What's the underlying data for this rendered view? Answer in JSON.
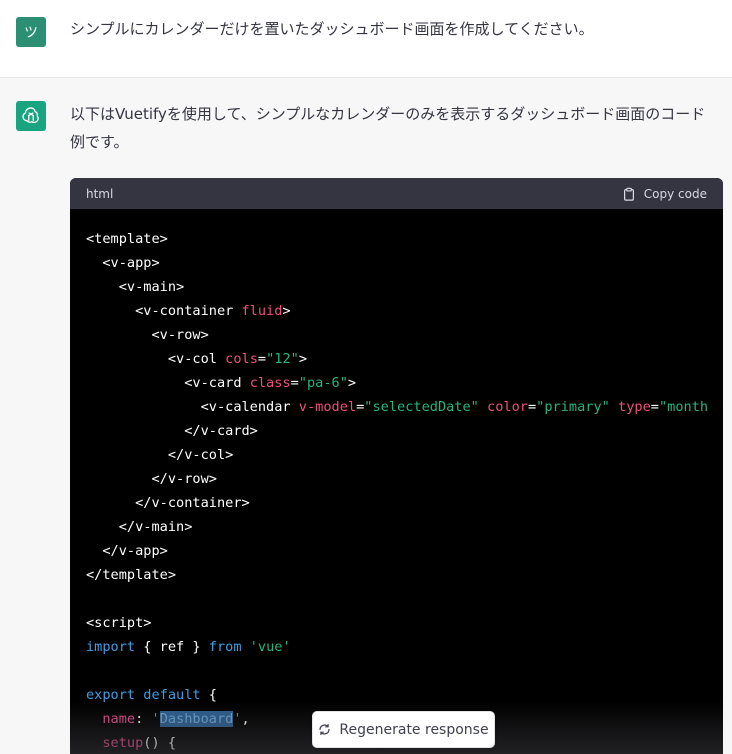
{
  "user_message": {
    "avatar_glyph": "ツ",
    "avatar_color": "#2a8f73",
    "text": "シンプルにカレンダーだけを置いたダッシュボード画面を作成してください。"
  },
  "assistant_message": {
    "avatar_icon": "openai-logo-icon",
    "avatar_color": "#19a37f",
    "text": "以下はVuetifyを使用して、シンプルなカレンダーのみを表示するダッシュボード画面のコード例です。"
  },
  "code_block": {
    "language": "html",
    "copy_label": "Copy code",
    "lines": [
      [
        {
          "t": "<template>",
          "c": "tag"
        }
      ],
      [
        {
          "t": "  <v-app>",
          "c": "tag"
        }
      ],
      [
        {
          "t": "    <v-main>",
          "c": "tag"
        }
      ],
      [
        {
          "t": "      <v-container ",
          "c": "tag"
        },
        {
          "t": "fluid",
          "c": "attr-pink"
        },
        {
          "t": ">",
          "c": "tag"
        }
      ],
      [
        {
          "t": "        <v-row>",
          "c": "tag"
        }
      ],
      [
        {
          "t": "          <v-col ",
          "c": "tag"
        },
        {
          "t": "cols",
          "c": "attr-pink"
        },
        {
          "t": "=",
          "c": "tag"
        },
        {
          "t": "\"12\"",
          "c": "str"
        },
        {
          "t": ">",
          "c": "tag"
        }
      ],
      [
        {
          "t": "            <v-card ",
          "c": "tag"
        },
        {
          "t": "class",
          "c": "attr-pink"
        },
        {
          "t": "=",
          "c": "tag"
        },
        {
          "t": "\"pa-6\"",
          "c": "str"
        },
        {
          "t": ">",
          "c": "tag"
        }
      ],
      [
        {
          "t": "              <v-calendar ",
          "c": "tag"
        },
        {
          "t": "v-model",
          "c": "attr-pink"
        },
        {
          "t": "=",
          "c": "tag"
        },
        {
          "t": "\"selectedDate\"",
          "c": "str"
        },
        {
          "t": " ",
          "c": "tag"
        },
        {
          "t": "color",
          "c": "attr-pink"
        },
        {
          "t": "=",
          "c": "tag"
        },
        {
          "t": "\"primary\"",
          "c": "str"
        },
        {
          "t": " ",
          "c": "tag"
        },
        {
          "t": "type",
          "c": "attr-pink"
        },
        {
          "t": "=",
          "c": "tag"
        },
        {
          "t": "\"month",
          "c": "str"
        }
      ],
      [
        {
          "t": "            </v-card>",
          "c": "tag"
        }
      ],
      [
        {
          "t": "          </v-col>",
          "c": "tag"
        }
      ],
      [
        {
          "t": "        </v-row>",
          "c": "tag"
        }
      ],
      [
        {
          "t": "      </v-container>",
          "c": "tag"
        }
      ],
      [
        {
          "t": "    </v-main>",
          "c": "tag"
        }
      ],
      [
        {
          "t": "  </v-app>",
          "c": "tag"
        }
      ],
      [
        {
          "t": "</template>",
          "c": "tag"
        }
      ],
      [
        {
          "t": "",
          "c": "tag"
        }
      ],
      [
        {
          "t": "<script>",
          "c": "tag"
        }
      ],
      [
        {
          "t": "import",
          "c": "kw"
        },
        {
          "t": " { ref } ",
          "c": "tag"
        },
        {
          "t": "from",
          "c": "kw"
        },
        {
          "t": " ",
          "c": "tag"
        },
        {
          "t": "'vue'",
          "c": "str"
        }
      ],
      [
        {
          "t": "",
          "c": "tag"
        }
      ],
      [
        {
          "t": "export",
          "c": "kw"
        },
        {
          "t": " ",
          "c": "tag"
        },
        {
          "t": "default",
          "c": "kw"
        },
        {
          "t": " {",
          "c": "tag"
        }
      ],
      [
        {
          "t": "  ",
          "c": "tag"
        },
        {
          "t": "name",
          "c": "fn"
        },
        {
          "t": ": ",
          "c": "tag"
        },
        {
          "t": "'",
          "c": "str"
        },
        {
          "t": "Dashboard",
          "c": "hl"
        },
        {
          "t": "'",
          "c": "str"
        },
        {
          "t": ",",
          "c": "tag"
        }
      ],
      [
        {
          "t": "  ",
          "c": "tag"
        },
        {
          "t": "setup",
          "c": "fn"
        },
        {
          "t": "() {",
          "c": "tag"
        }
      ]
    ]
  },
  "regenerate_button": {
    "label": "Regenerate response",
    "icon": "refresh-icon"
  }
}
